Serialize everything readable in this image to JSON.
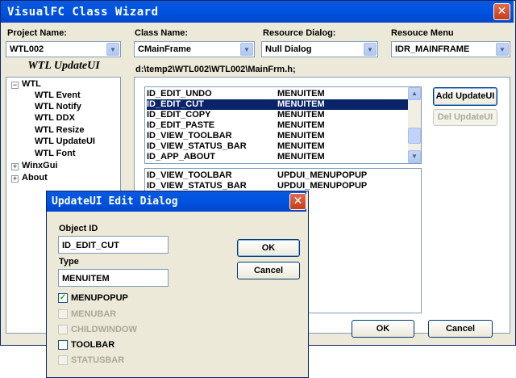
{
  "window": {
    "title": "VisualFC Class Wizard",
    "close_glyph": "✕"
  },
  "project": {
    "label": "Project Name:",
    "value": "WTL002"
  },
  "class_name": {
    "label": "Class Name:",
    "value": "CMainFrame"
  },
  "resource_dialog": {
    "label": "Resource Dialog:",
    "value": "Null Dialog"
  },
  "resource_menu": {
    "label": "Resouce Menu",
    "value": "IDR_MAINFRAME"
  },
  "tree": {
    "header": "WTL UpdateUI",
    "items": [
      {
        "label": "WTL",
        "toggle": "−"
      },
      {
        "label": "WTL Event"
      },
      {
        "label": "WTL Notify"
      },
      {
        "label": "WTL DDX"
      },
      {
        "label": "WTL Resize"
      },
      {
        "label": "WTL UpdateUI"
      },
      {
        "label": "WTL Font"
      },
      {
        "label": "WinxGui",
        "toggle": "+"
      },
      {
        "label": "About",
        "toggle": "+"
      }
    ]
  },
  "path": "d:\\temp2\\WTL002\\WTL002\\MainFrm.h;",
  "menu_list": {
    "rows": [
      {
        "id": "ID_EDIT_UNDO",
        "type": "MENUITEM"
      },
      {
        "id": "ID_EDIT_CUT",
        "type": "MENUITEM"
      },
      {
        "id": "ID_EDIT_COPY",
        "type": "MENUITEM"
      },
      {
        "id": "ID_EDIT_PASTE",
        "type": "MENUITEM"
      },
      {
        "id": "ID_VIEW_TOOLBAR",
        "type": "MENUITEM"
      },
      {
        "id": "ID_VIEW_STATUS_BAR",
        "type": "MENUITEM"
      },
      {
        "id": "ID_APP_ABOUT",
        "type": "MENUITEM"
      }
    ],
    "selected_index": 1
  },
  "update_list": {
    "rows": [
      {
        "id": "ID_VIEW_TOOLBAR",
        "type": "UPDUI_MENUPOPUP"
      },
      {
        "id": "ID_VIEW_STATUS_BAR",
        "type": "UPDUI_MENUPOPUP"
      }
    ]
  },
  "buttons": {
    "add": "Add UpdateUI",
    "del": "Del UpdateUI",
    "ok": "OK",
    "cancel": "Cancel"
  },
  "dialog": {
    "title": "UpdateUI Edit Dialog",
    "close_glyph": "✕",
    "object_id_label": "Object ID",
    "object_id_value": "ID_EDIT_CUT",
    "type_label": "Type",
    "type_value": "MENUITEM",
    "ok": "OK",
    "cancel": "Cancel",
    "checkboxes": [
      {
        "label": "MENUPOPUP",
        "checked": true,
        "enabled": true
      },
      {
        "label": "MENUBAR",
        "checked": false,
        "enabled": false
      },
      {
        "label": "CHILDWINDOW",
        "checked": false,
        "enabled": false
      },
      {
        "label": "TOOLBAR",
        "checked": false,
        "enabled": true
      },
      {
        "label": "STATUSBAR",
        "checked": false,
        "enabled": false
      }
    ]
  },
  "colors": {
    "titlebar": "#0054e3",
    "selection": "#0a246a",
    "checkmark": "#21a121",
    "disabled_text": "#aca899"
  }
}
